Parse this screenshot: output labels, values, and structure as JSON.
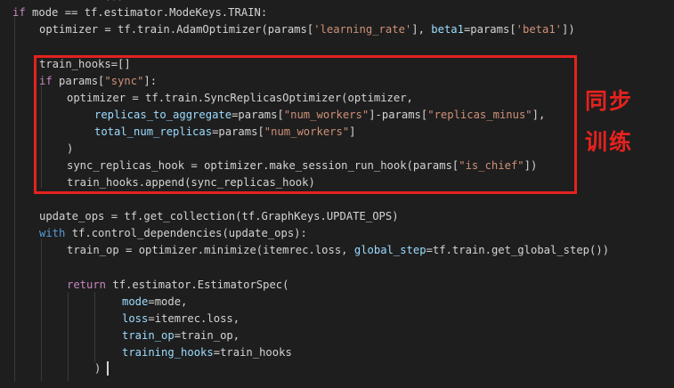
{
  "editor": {
    "faint_top_text": "...",
    "lines": [
      {
        "tokens": [
          {
            "t": "if",
            "c": "kw2"
          },
          {
            "t": " mode == tf.estimator.ModeKeys.TRAIN:",
            "c": "txt"
          }
        ]
      },
      {
        "tokens": [
          {
            "t": "optimizer = tf.train.AdamOptimizer(params[",
            "c": "txt"
          },
          {
            "t": "'learning_rate'",
            "c": "str"
          },
          {
            "t": "], ",
            "c": "txt"
          },
          {
            "t": "beta1",
            "c": "param"
          },
          {
            "t": "=params[",
            "c": "txt"
          },
          {
            "t": "'beta1'",
            "c": "str"
          },
          {
            "t": "])",
            "c": "txt"
          }
        ]
      },
      {
        "tokens": [
          {
            "t": "train_hooks=[]",
            "c": "txt"
          }
        ]
      },
      {
        "tokens": [
          {
            "t": "if",
            "c": "kw2"
          },
          {
            "t": " params[",
            "c": "txt"
          },
          {
            "t": "\"sync\"",
            "c": "str"
          },
          {
            "t": "]:",
            "c": "txt"
          }
        ]
      },
      {
        "tokens": [
          {
            "t": "optimizer = tf.train.SyncReplicasOptimizer(optimizer,",
            "c": "txt"
          }
        ]
      },
      {
        "tokens": [
          {
            "t": "replicas_to_aggregate",
            "c": "param"
          },
          {
            "t": "=params[",
            "c": "txt"
          },
          {
            "t": "\"num_workers\"",
            "c": "str"
          },
          {
            "t": "]-params[",
            "c": "txt"
          },
          {
            "t": "\"replicas_minus\"",
            "c": "str"
          },
          {
            "t": "],",
            "c": "txt"
          }
        ]
      },
      {
        "tokens": [
          {
            "t": "total_num_replicas",
            "c": "param"
          },
          {
            "t": "=params[",
            "c": "txt"
          },
          {
            "t": "\"num_workers\"",
            "c": "str"
          },
          {
            "t": "]",
            "c": "txt"
          }
        ]
      },
      {
        "tokens": [
          {
            "t": ")",
            "c": "txt"
          }
        ]
      },
      {
        "tokens": [
          {
            "t": "sync_replicas_hook = optimizer.make_session_run_hook(params[",
            "c": "txt"
          },
          {
            "t": "\"is_chief\"",
            "c": "str"
          },
          {
            "t": "])",
            "c": "txt"
          }
        ]
      },
      {
        "tokens": [
          {
            "t": "train_hooks.append(sync_replicas_hook)",
            "c": "txt"
          }
        ]
      },
      {
        "tokens": [
          {
            "t": "update_ops = tf.get_collection(tf.GraphKeys.UPDATE_OPS)",
            "c": "txt"
          }
        ]
      },
      {
        "tokens": [
          {
            "t": "with",
            "c": "kw"
          },
          {
            "t": " tf.control_dependencies(update_ops):",
            "c": "txt"
          }
        ]
      },
      {
        "tokens": [
          {
            "t": "train_op = optimizer.minimize(itemrec.loss, ",
            "c": "txt"
          },
          {
            "t": "global_step",
            "c": "param"
          },
          {
            "t": "=tf.train.get_global_step())",
            "c": "txt"
          }
        ]
      },
      {
        "tokens": [
          {
            "t": "return",
            "c": "kw2"
          },
          {
            "t": " tf.estimator.EstimatorSpec(",
            "c": "txt"
          }
        ]
      },
      {
        "tokens": [
          {
            "t": "mode",
            "c": "param"
          },
          {
            "t": "=mode,",
            "c": "txt"
          }
        ]
      },
      {
        "tokens": [
          {
            "t": "loss",
            "c": "param"
          },
          {
            "t": "=itemrec.loss,",
            "c": "txt"
          }
        ]
      },
      {
        "tokens": [
          {
            "t": "train_op",
            "c": "param"
          },
          {
            "t": "=train_op,",
            "c": "txt"
          }
        ]
      },
      {
        "tokens": [
          {
            "t": "training_hooks",
            "c": "param"
          },
          {
            "t": "=train_hooks",
            "c": "txt"
          }
        ]
      },
      {
        "tokens": [
          {
            "t": ")",
            "c": "txt"
          }
        ]
      }
    ]
  },
  "annotation": {
    "line1": "同步",
    "line2": "训练",
    "color": "#e5221f"
  },
  "colors": {
    "background": "#1e1e1e",
    "keyword": "#569cd6",
    "control_keyword": "#c586c0",
    "string": "#ce9178",
    "parameter": "#9cdcfe",
    "text": "#d4d4d4"
  }
}
